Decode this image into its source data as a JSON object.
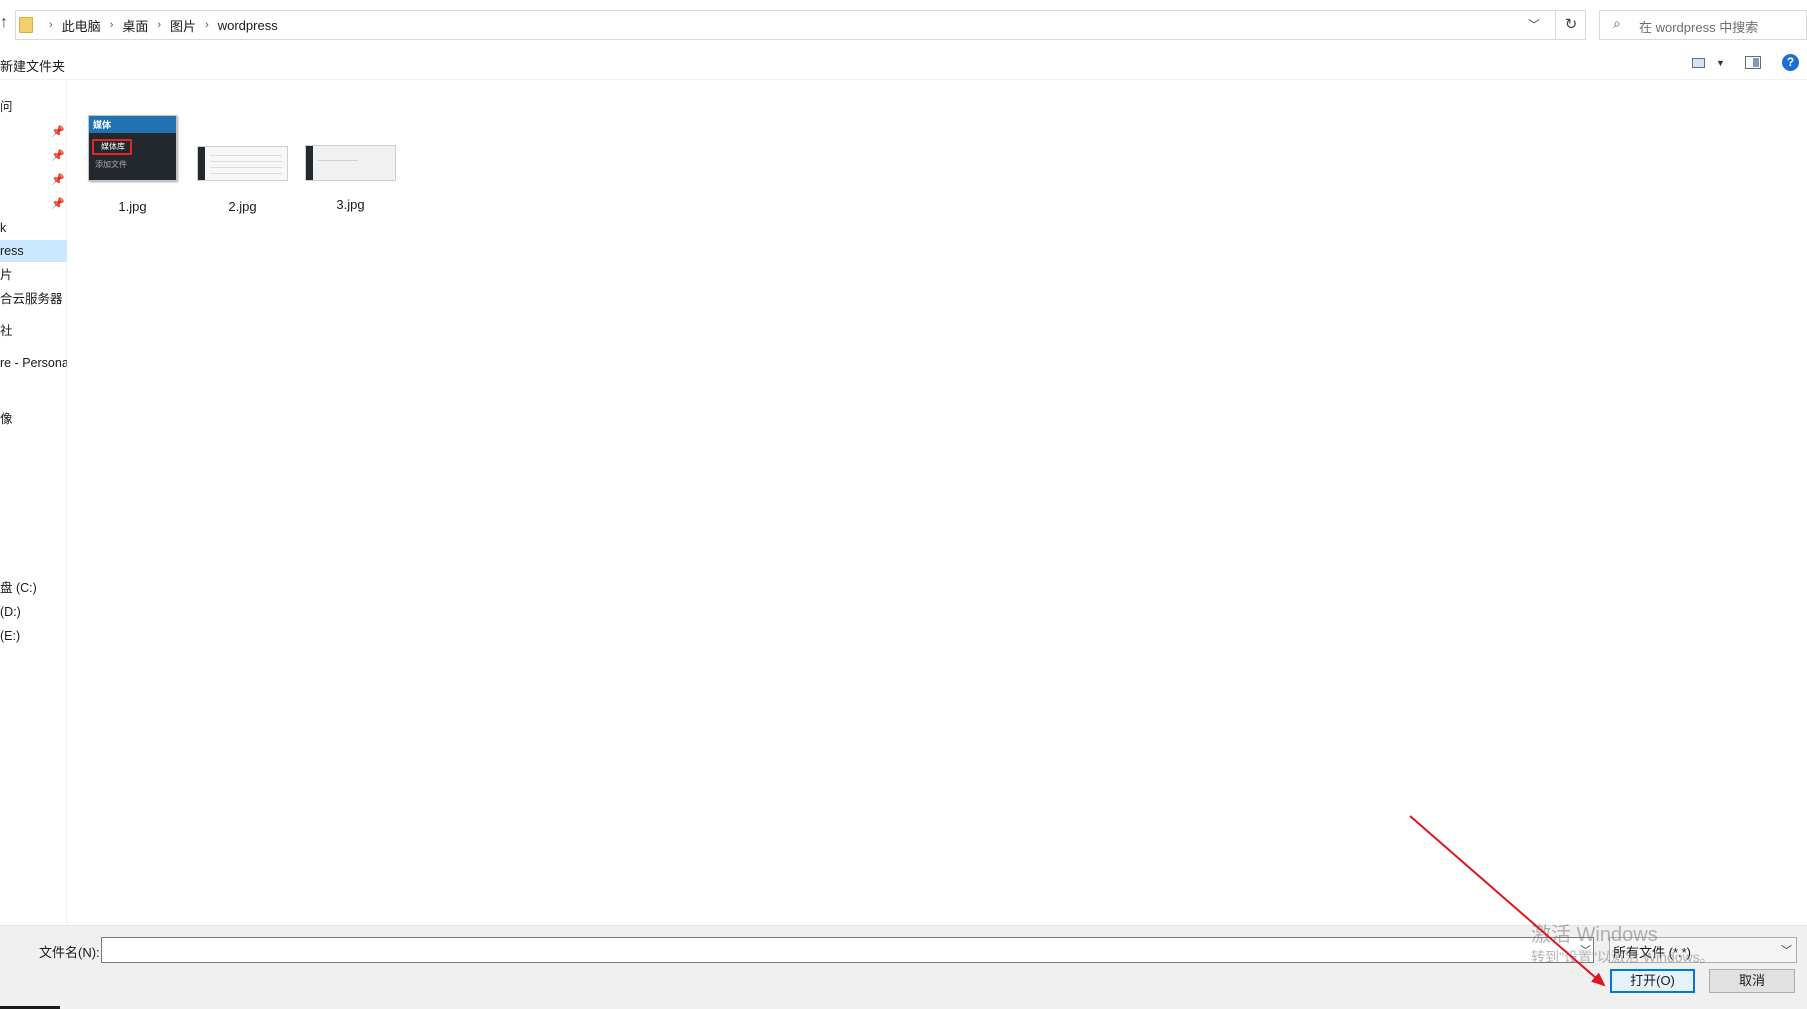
{
  "address_bar": {
    "up_glyph": "↑",
    "breadcrumbs": [
      "此电脑",
      "桌面",
      "图片",
      "wordpress"
    ],
    "refresh_glyph": "↻",
    "search_placeholder": "在 wordpress 中搜索"
  },
  "toolbar": {
    "new_folder_label": "新建文件夹",
    "help_glyph": "?"
  },
  "nav_pane": {
    "items": [
      {
        "label": "问"
      },
      {
        "label": "k"
      },
      {
        "label": "ress",
        "selected": true
      },
      {
        "label": "片"
      },
      {
        "label": "合云服务器"
      },
      {
        "label": "社"
      },
      {
        "label": "re - Persona"
      },
      {
        "label": "像"
      },
      {
        "label": "盘 (C:)"
      },
      {
        "label": "(D:)"
      },
      {
        "label": "(E:)"
      }
    ],
    "pin_count": 4
  },
  "files": [
    {
      "name": "1.jpg",
      "thumb": {
        "header": "媒体",
        "highlight": "媒体库",
        "sub": "添加文件"
      }
    },
    {
      "name": "2.jpg"
    },
    {
      "name": "3.jpg"
    }
  ],
  "bottom": {
    "filename_label": "文件名(N):",
    "filename_value": "",
    "filter_value": "所有文件 (*.*)",
    "open_label": "打开(O)",
    "cancel_label": "取消"
  },
  "watermark": {
    "line1": "激活 Windows",
    "line2": "转到\"设置\"以激活 Windows。"
  },
  "colors": {
    "selection": "#cce8ff",
    "accent": "#0078d7",
    "annotation_arrow": "#e0151b"
  }
}
